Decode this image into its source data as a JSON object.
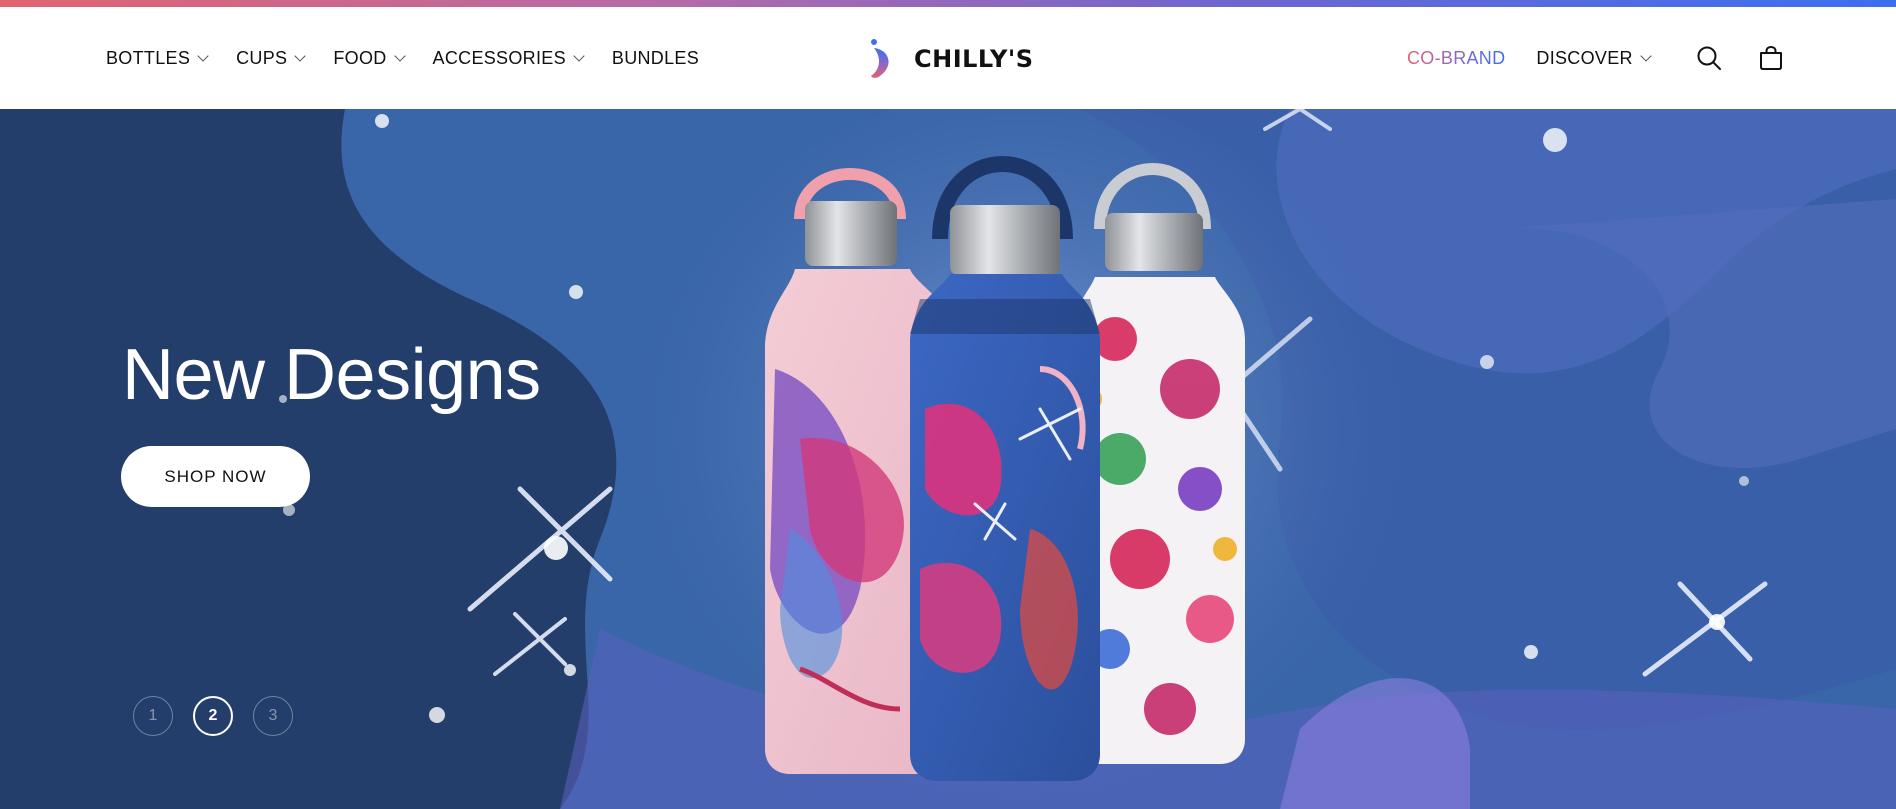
{
  "brand": {
    "name": "CHILLY'S",
    "gradient": [
      "#e2636f",
      "#8a67c9",
      "#3b6ff0"
    ]
  },
  "nav": {
    "left": [
      {
        "label": "BOTTLES",
        "has_dropdown": true
      },
      {
        "label": "CUPS",
        "has_dropdown": true
      },
      {
        "label": "FOOD",
        "has_dropdown": true
      },
      {
        "label": "ACCESSORIES",
        "has_dropdown": true
      },
      {
        "label": "BUNDLES",
        "has_dropdown": false
      }
    ],
    "right": {
      "cobrand_label": "CO-BRAND",
      "discover_label": "DISCOVER",
      "search_icon": "search-icon",
      "cart_icon": "shopping-bag-icon"
    }
  },
  "hero": {
    "title": "New Designs",
    "cta_label": "SHOP NOW",
    "background_color": "#243e6c",
    "slides": [
      "1",
      "2",
      "3"
    ],
    "active_slide": "2"
  }
}
